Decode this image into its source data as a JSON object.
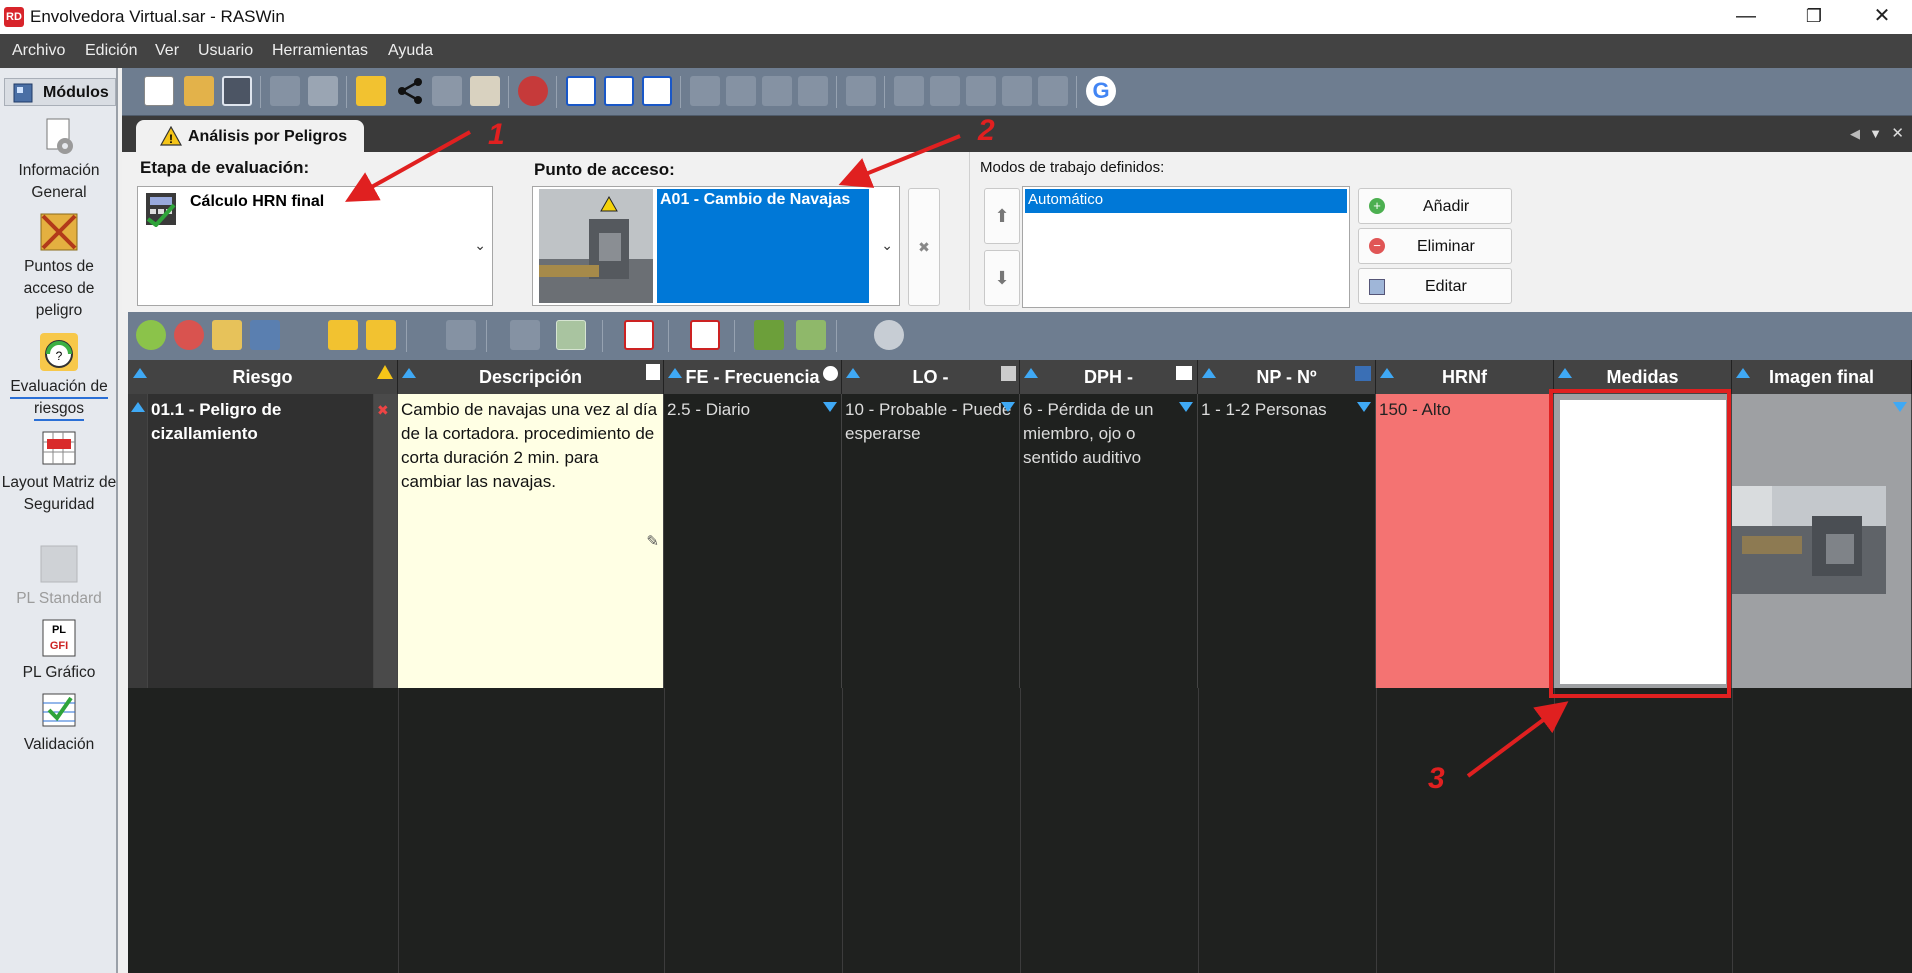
{
  "window": {
    "title": "Envolvedora Virtual.sar - RASWin",
    "app_icon": "RD",
    "minimize": "—",
    "maximize": "❐",
    "close": "✕"
  },
  "menu": [
    "Archivo",
    "Edición",
    "Ver",
    "Usuario",
    "Herramientas",
    "Ayuda"
  ],
  "modules": {
    "header": "Módulos",
    "items": [
      {
        "label": "Información General",
        "icon": "info-doc-icon",
        "state": "normal"
      },
      {
        "label": "Puntos de acceso de peligro",
        "icon": "hazard-points-icon",
        "state": "normal"
      },
      {
        "label": "Evaluación de riesgos",
        "icon": "risk-gauge-icon",
        "state": "selected"
      },
      {
        "label": "Layout Matriz de Seguridad",
        "icon": "sms-matrix-icon",
        "state": "normal"
      },
      {
        "label": "PL Standard",
        "icon": "pl-standard-icon",
        "state": "disabled"
      },
      {
        "label": "PL Gráfico",
        "icon": "pl-graph-icon",
        "state": "normal"
      },
      {
        "label": "Validación",
        "icon": "validation-icon",
        "state": "normal"
      }
    ]
  },
  "tab": {
    "label": "Análisis por Peligros"
  },
  "etapa": {
    "label": "Etapa de evaluación:",
    "value": "Cálculo HRN final"
  },
  "punto": {
    "label": "Punto de acceso:",
    "value": "A01 - Cambio de Navajas",
    "clear": "✖"
  },
  "modos": {
    "label": "Modos de trabajo definidos:",
    "selected": "Automático",
    "add": "Añadir",
    "delete": "Eliminar",
    "edit": "Editar"
  },
  "annotations": {
    "a1": "1",
    "a2": "2",
    "a3": "3"
  },
  "grid": {
    "headers": [
      "Riesgo",
      "Descripción",
      "FE - Frecuencia",
      "LO -",
      "DPH -",
      "NP - Nº",
      "HRNf",
      "Medidas",
      "Imagen final"
    ],
    "row": {
      "riesgo": "01.1 - Peligro de cizallamiento",
      "descripcion": "Cambio de navajas una vez al día de la cortadora. procedimiento de corta duración 2 min. para cambiar las navajas.",
      "fe": "2.5 - Diario",
      "lo": "10 - Probable - Puede esperarse",
      "dph": "6 - Pérdida de un miembro, ojo o sentido auditivo",
      "np": "1 - 1-2 Personas",
      "hrnf": "150 - Alto",
      "medidas": "",
      "imagen": ""
    }
  },
  "colors": {
    "hrnf_bg": "#f47372",
    "desc_bg": "#ffffe4",
    "selected_blue": "#0078d7",
    "annotation_red": "#e02020"
  }
}
